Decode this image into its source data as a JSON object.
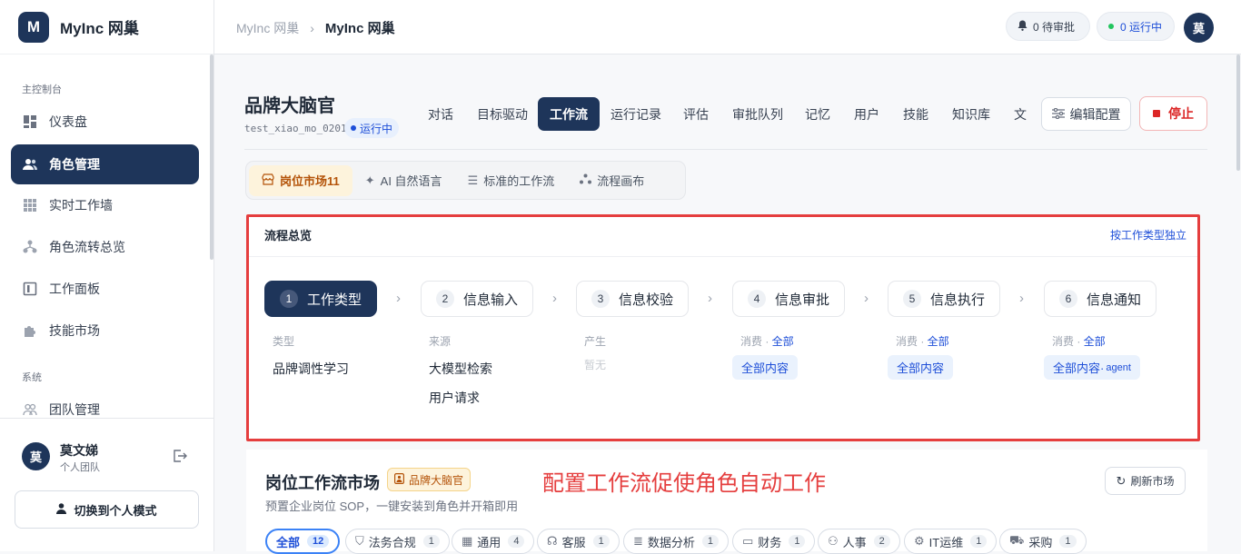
{
  "app": {
    "initial": "M",
    "name": "MyInc 网巢"
  },
  "sidebar": {
    "section_main": "主控制台",
    "section_system": "系统",
    "items": [
      {
        "label": "仪表盘",
        "icon": "dashboard-icon"
      },
      {
        "label": "角色管理",
        "icon": "users-icon"
      },
      {
        "label": "实时工作墙",
        "icon": "grid-icon"
      },
      {
        "label": "角色流转总览",
        "icon": "flow-icon"
      },
      {
        "label": "工作面板",
        "icon": "panel-icon"
      },
      {
        "label": "技能市场",
        "icon": "puzzle-icon"
      },
      {
        "label": "团队管理",
        "icon": "team-icon"
      }
    ],
    "user": {
      "initial": "莫",
      "name": "莫文娣",
      "team": "个人团队"
    },
    "switch_label": "切换到个人模式"
  },
  "topbar": {
    "breadcrumb_root": "MyInc 网巢",
    "breadcrumb_current": "MyInc 网巢",
    "pending": "0 待审批",
    "running": "0 运行中",
    "avatar": "莫"
  },
  "agent": {
    "name": "品牌大脑官",
    "id": "test_xiao_mo_0201",
    "status": "运行中"
  },
  "tabs": [
    "对话",
    "目标驱动",
    "工作流",
    "运行记录",
    "评估",
    "审批队列",
    "记忆",
    "用户",
    "技能",
    "知识库",
    "文"
  ],
  "actions": {
    "edit": "编辑配置",
    "stop": "停止"
  },
  "subtabs": [
    "岗位市场11",
    "AI 自然语言",
    "标准的工作流",
    "流程画布"
  ],
  "overview": {
    "title": "流程总览",
    "link": "按工作类型独立",
    "steps": [
      {
        "n": "1",
        "label": "工作类型"
      },
      {
        "n": "2",
        "label": "信息输入"
      },
      {
        "n": "3",
        "label": "信息校验"
      },
      {
        "n": "4",
        "label": "信息审批"
      },
      {
        "n": "5",
        "label": "信息执行"
      },
      {
        "n": "6",
        "label": "信息通知"
      }
    ],
    "col1": {
      "label": "类型",
      "value": "品牌调性学习"
    },
    "col2": {
      "label": "来源",
      "values": [
        "大模型检索",
        "用户请求"
      ]
    },
    "col3": {
      "label": "产生",
      "value": "暂无"
    },
    "consume_prefix": "消费 · ",
    "consume_all": "全部",
    "tag_all": "全部内容",
    "tag_agent_main": "全部内容·",
    "tag_agent_sub": "agent"
  },
  "market": {
    "title": "岗位工作流市场",
    "badge": "品牌大脑官",
    "subtitle": "预置企业岗位 SOP，一键安装到角色并开箱即用",
    "refresh": "刷新市场",
    "annotation": "配置工作流促使角色自动工作",
    "chips": [
      {
        "label": "全部",
        "count": "12"
      },
      {
        "label": "法务合规",
        "count": "1"
      },
      {
        "label": "通用",
        "count": "4"
      },
      {
        "label": "客服",
        "count": "1"
      },
      {
        "label": "数据分析",
        "count": "1"
      },
      {
        "label": "财务",
        "count": "1"
      },
      {
        "label": "人事",
        "count": "2"
      },
      {
        "label": "IT运维",
        "count": "1"
      },
      {
        "label": "采购",
        "count": "1"
      }
    ]
  },
  "colors": {
    "primary": "#1e355a",
    "highlight": "#e53e3e",
    "link": "#1d4ed8"
  }
}
